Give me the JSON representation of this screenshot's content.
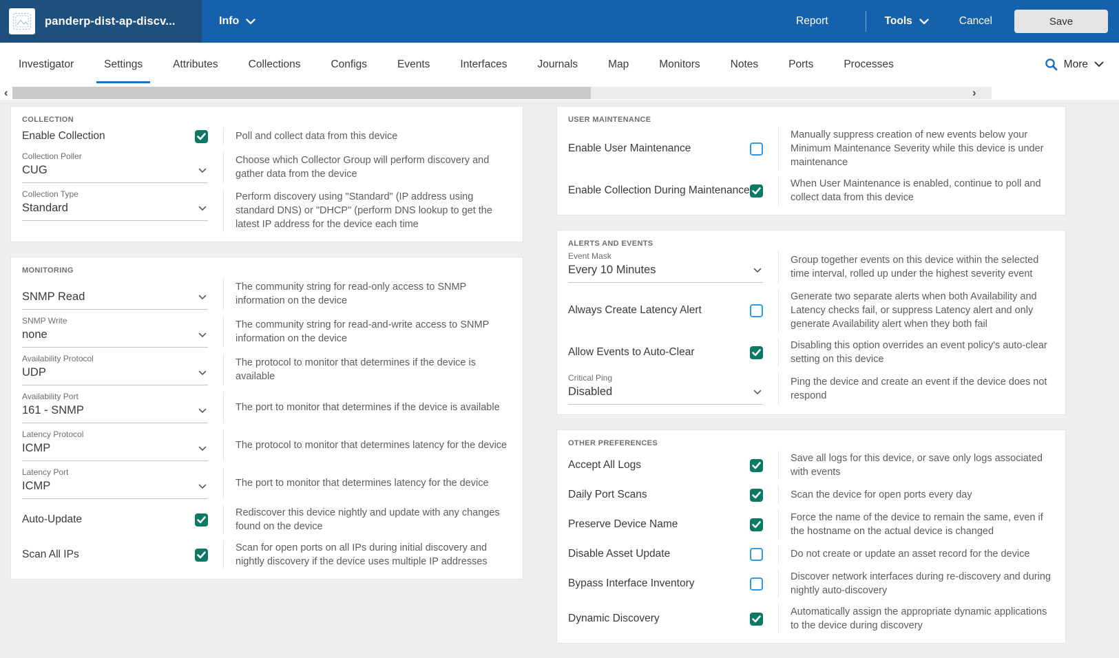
{
  "header": {
    "device_name": "panderp-dist-ap-discv...",
    "info_label": "Info",
    "report_label": "Report",
    "tools_label": "Tools",
    "cancel_label": "Cancel",
    "save_label": "Save"
  },
  "tabs": {
    "items": [
      "Investigator",
      "Settings",
      "Attributes",
      "Collections",
      "Configs",
      "Events",
      "Interfaces",
      "Journals",
      "Map",
      "Monitors",
      "Notes",
      "Ports",
      "Processes"
    ],
    "active_index": 1,
    "more_label": "More"
  },
  "scrollbar": {
    "left_arrow": "‹",
    "right_arrow": "›"
  },
  "colors": {
    "header_blue": "#1561ac",
    "header_dark_blue": "#1f4f7d",
    "active_tab_underline": "#1277d3",
    "checked_checkbox_teal": "#0a7a66",
    "unchecked_checkbox_border": "#2f9ae0",
    "search_icon_blue": "#1b6fc6",
    "save_button_gray": "#e4e4e4"
  },
  "cards": {
    "left": [
      {
        "title": "COLLECTION",
        "rows": [
          {
            "type": "checkbox",
            "label": "Enable Collection",
            "checked": true,
            "desc": "Poll and collect data from this device"
          },
          {
            "type": "select",
            "label": "Collection Poller",
            "value": "CUG",
            "desc": "Choose which Collector Group will perform discovery and gather data from the device"
          },
          {
            "type": "select",
            "label": "Collection Type",
            "value": "Standard",
            "desc": "Perform discovery using \"Standard\" (IP address using standard DNS) or \"DHCP\" (perform DNS lookup to get the latest IP address for the device each time"
          }
        ]
      },
      {
        "title": "MONITORING",
        "rows": [
          {
            "type": "select",
            "label": "",
            "value": "SNMP Read",
            "desc": "The community string for read-only access to SNMP information on the device"
          },
          {
            "type": "select",
            "label": "SNMP Write",
            "value": "none",
            "desc": "The community string for read-and-write access to SNMP information on the device"
          },
          {
            "type": "select",
            "label": "Availability Protocol",
            "value": "UDP",
            "desc": "The protocol to monitor that determines if the device is available"
          },
          {
            "type": "select",
            "label": "Availability Port",
            "value": "161 - SNMP",
            "desc": "The port to monitor that determines if the device is available"
          },
          {
            "type": "select",
            "label": "Latency Protocol",
            "value": "ICMP",
            "desc": "The protocol to monitor that determines latency for the device"
          },
          {
            "type": "select",
            "label": "Latency Port",
            "value": "ICMP",
            "desc": "The port to monitor that determines latency for the device"
          },
          {
            "type": "checkbox",
            "label": "Auto-Update",
            "checked": true,
            "desc": "Rediscover this device nightly and update with any changes found on the device"
          },
          {
            "type": "checkbox",
            "label": "Scan All IPs",
            "checked": true,
            "desc": "Scan for open ports on all IPs during initial discovery and nightly discovery if the device uses multiple IP addresses"
          }
        ]
      }
    ],
    "right": [
      {
        "title": "USER MAINTENANCE",
        "rows": [
          {
            "type": "checkbox",
            "label": "Enable User Maintenance",
            "checked": false,
            "desc": "Manually suppress creation of new events below your Minimum Maintenance Severity while this device is under maintenance"
          },
          {
            "type": "checkbox",
            "label": "Enable Collection During Maintenance",
            "checked": true,
            "desc": "When User Maintenance is enabled, continue to poll and collect data from this device"
          }
        ]
      },
      {
        "title": "ALERTS AND EVENTS",
        "rows": [
          {
            "type": "select",
            "label": "Event Mask",
            "value": "Every 10 Minutes",
            "desc": "Group together events on this device within the selected time interval, rolled up under the highest severity event"
          },
          {
            "type": "checkbox",
            "label": "Always Create Latency Alert",
            "checked": false,
            "desc": "Generate two separate alerts when both Availability and Latency checks fail, or suppress Latency alert and only generate Availability alert when they both fail"
          },
          {
            "type": "checkbox",
            "label": "Allow Events to Auto-Clear",
            "checked": true,
            "desc": "Disabling this option overrides an event policy's auto-clear setting on this device"
          },
          {
            "type": "select",
            "label": "Critical Ping",
            "value": "Disabled",
            "desc": "Ping the device and create an event if the device does not respond"
          }
        ]
      },
      {
        "title": "OTHER PREFERENCES",
        "rows": [
          {
            "type": "checkbox",
            "label": "Accept All Logs",
            "checked": true,
            "desc": "Save all logs for this device, or save only logs associated with events"
          },
          {
            "type": "checkbox",
            "label": "Daily Port Scans",
            "checked": true,
            "desc": "Scan the device for open ports every day"
          },
          {
            "type": "checkbox",
            "label": "Preserve Device Name",
            "checked": true,
            "desc": "Force the name of the device to remain the same, even if the hostname on the actual device is changed"
          },
          {
            "type": "checkbox",
            "label": "Disable Asset Update",
            "checked": false,
            "desc": "Do not create or update an asset record for the device"
          },
          {
            "type": "checkbox",
            "label": "Bypass Interface Inventory",
            "checked": false,
            "desc": "Discover network interfaces during re-discovery and during nightly auto-discovery"
          },
          {
            "type": "checkbox",
            "label": "Dynamic Discovery",
            "checked": true,
            "desc": "Automatically assign the appropriate dynamic applications to the device during discovery"
          }
        ]
      }
    ]
  }
}
